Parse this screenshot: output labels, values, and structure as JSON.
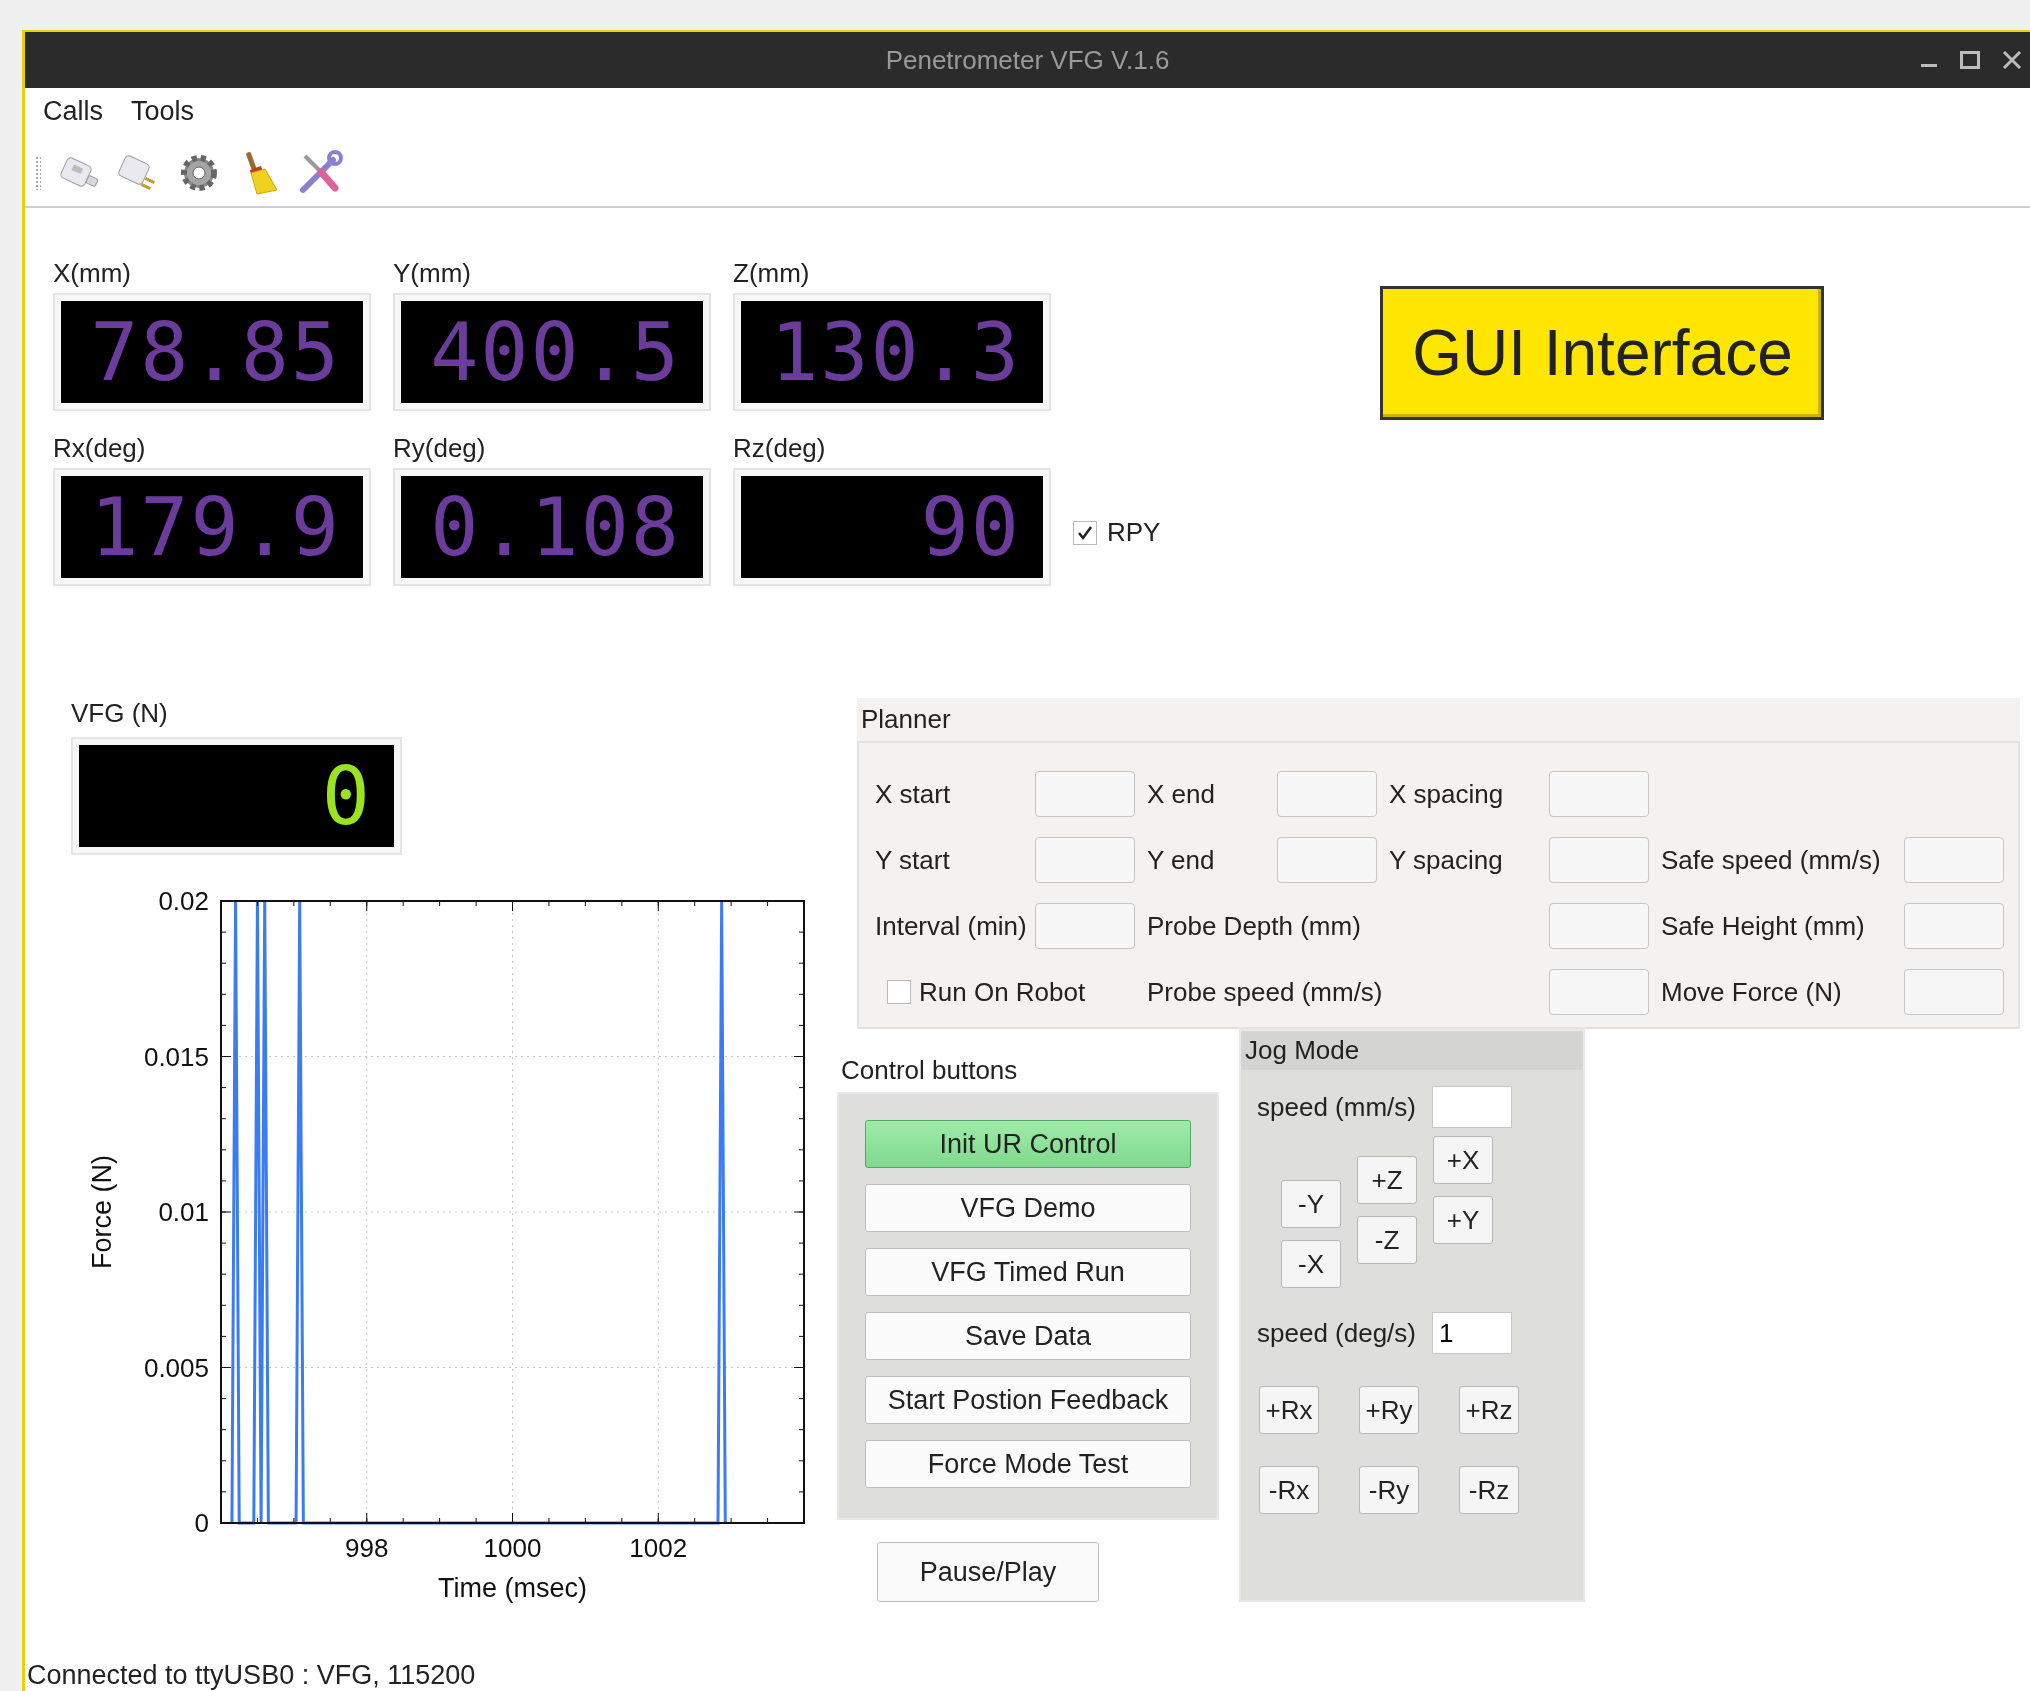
{
  "window": {
    "title": "Penetrometer VFG V.1.6"
  },
  "menu": [
    "Calls",
    "Tools"
  ],
  "readouts": [
    {
      "label": "X(mm)",
      "value": "78.85"
    },
    {
      "label": "Y(mm)",
      "value": "400.5"
    },
    {
      "label": "Z(mm)",
      "value": "130.3"
    },
    {
      "label": "Rx(deg)",
      "value": "179.9"
    },
    {
      "label": "Ry(deg)",
      "value": "0.108"
    },
    {
      "label": "Rz(deg)",
      "value": "90"
    }
  ],
  "rpy": {
    "label": "RPY",
    "checked": true
  },
  "banner": {
    "text": "GUI Interface"
  },
  "vfg": {
    "label": "VFG (N)",
    "value": "0"
  },
  "plot": {
    "chart_data": {
      "type": "line",
      "xlabel": "Time (msec)",
      "ylabel": "Force (N)",
      "x": [
        996.15,
        996.2,
        996.25,
        996.45,
        996.5,
        996.55,
        996.55,
        996.6,
        996.65,
        997.03,
        997.08,
        997.13,
        1002.82,
        1002.87,
        1002.92
      ],
      "series": [
        {
          "color": "#3b7cf5",
          "values": [
            0,
            0.02,
            0,
            0,
            0.02,
            0,
            0,
            0.02,
            0,
            0,
            0.02,
            0,
            0,
            0.02,
            0
          ]
        }
      ],
      "grid": true,
      "xlim": [
        996,
        1004
      ],
      "ylim": [
        0,
        0.02
      ],
      "xticks": [
        998,
        1000,
        1002
      ],
      "yticks": [
        {
          "value": 0,
          "label": "0"
        },
        {
          "value": 0.005,
          "label": "0.005"
        },
        {
          "value": 0.01,
          "label": "0.01"
        },
        {
          "value": 0.015,
          "label": "0.015"
        },
        {
          "value": 0.02,
          "label": "0.02"
        }
      ]
    }
  },
  "planner": {
    "title": "Planner",
    "rows": [
      [
        {
          "kind": "field",
          "label": "X start"
        },
        {
          "kind": "field",
          "label": "X end"
        },
        {
          "kind": "field",
          "label": "X spacing"
        },
        ""
      ],
      [
        {
          "kind": "field",
          "label": "Y start"
        },
        {
          "kind": "field",
          "label": "Y end"
        },
        {
          "kind": "field",
          "label": "Y spacing"
        },
        {
          "kind": "field",
          "label": "Safe speed (mm/s)"
        }
      ],
      [
        {
          "kind": "field",
          "label": "Interval (min)"
        },
        {
          "kind": "field",
          "label": "Probe Depth (mm)"
        },
        "",
        {
          "kind": "field",
          "label": "Safe Height (mm)"
        }
      ],
      [
        {
          "kind": "checkbox",
          "label": "Run On Robot",
          "checked": false
        },
        {
          "kind": "field",
          "label": "Probe speed (mm/s)"
        },
        "",
        {
          "kind": "field",
          "label": "Move Force (N)"
        }
      ]
    ]
  },
  "control_buttons": {
    "title": "Control buttons",
    "buttons": [
      {
        "label": "Init UR Control",
        "highlighted": true
      },
      {
        "label": "VFG Demo",
        "highlighted": false
      },
      {
        "label": "VFG Timed Run",
        "highlighted": false
      },
      {
        "label": "Save Data",
        "highlighted": false
      },
      {
        "label": "Start Postion Feedback",
        "highlighted": false
      },
      {
        "label": "Force Mode Test",
        "highlighted": false
      }
    ]
  },
  "pause_button": "Pause/Play",
  "jog_mode": {
    "title": "Jog Mode",
    "linear_speed": {
      "label": "speed (mm/s)"
    },
    "linear_columns": [
      [
        "-Y",
        "-X"
      ],
      [
        "+Z",
        "-Z"
      ],
      [
        "+X",
        "+Y"
      ]
    ],
    "angular_speed": {
      "label": "speed (deg/s)",
      "value": "1"
    },
    "angular_rows": [
      [
        "+Rx",
        "+Ry",
        "+Rz"
      ],
      [
        "-Rx",
        "-Ry",
        "-Rz"
      ]
    ]
  },
  "status_bar": "Connected to ttyUSB0 : VFG, 115200"
}
